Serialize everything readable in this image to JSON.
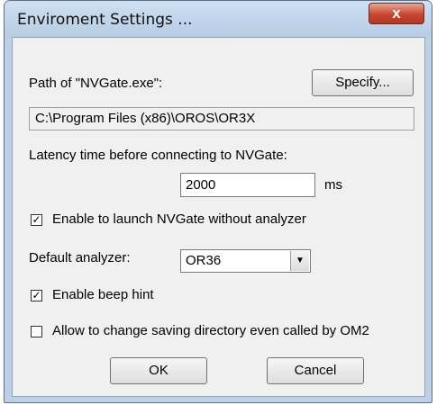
{
  "window": {
    "title": "Enviroment Settings ...",
    "close_label": "x"
  },
  "path": {
    "label": "Path of \"NVGate.exe\":",
    "specify_label": "Specify...",
    "value": "C:\\Program Files (x86)\\OROS\\OR3X"
  },
  "latency": {
    "label": "Latency time before connecting to NVGate:",
    "value": "2000",
    "unit": "ms"
  },
  "options": {
    "launch_without_analyzer": {
      "label": "Enable to launch NVGate without analyzer",
      "checked": true,
      "mark": "✓"
    },
    "beep_hint": {
      "label": "Enable beep hint",
      "checked": true,
      "mark": "✓"
    },
    "change_saving_dir": {
      "label": "Allow to change saving directory even called by OM2",
      "checked": false,
      "mark": ""
    }
  },
  "analyzer": {
    "label": "Default analyzer:",
    "selected": "OR36",
    "arrow": "▼"
  },
  "buttons": {
    "ok_label": "OK",
    "cancel_label": "Cancel"
  }
}
